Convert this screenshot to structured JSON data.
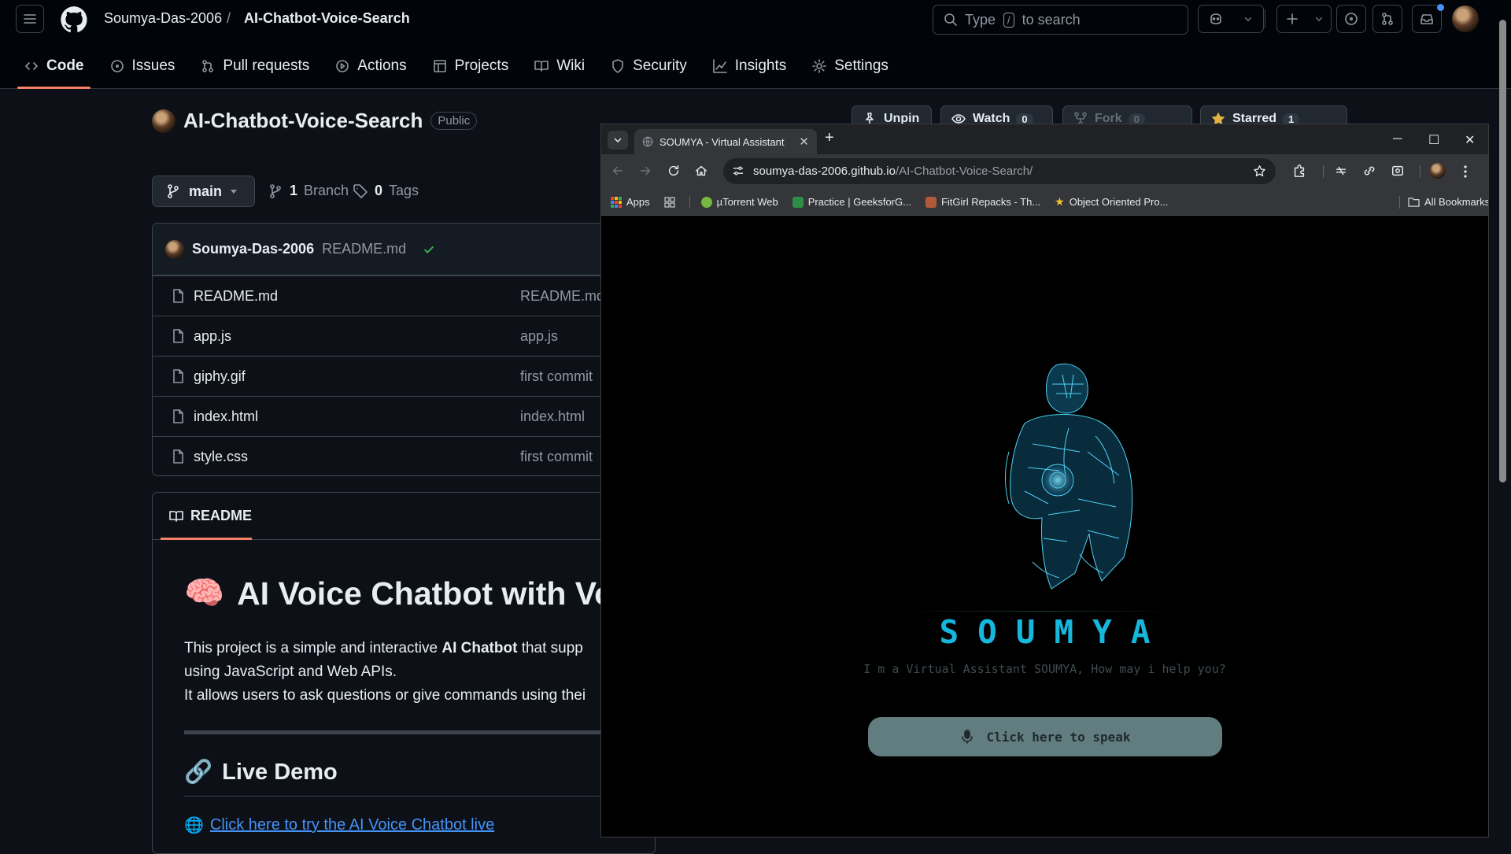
{
  "github": {
    "header": {
      "owner": "Soumya-Das-2006",
      "separator": "/",
      "repo": "AI-Chatbot-Voice-Search",
      "search": {
        "prefix": "Type",
        "key": "/",
        "suffix": "to search"
      }
    },
    "tabs": [
      {
        "label": "Code",
        "icon": "code-icon",
        "active": true
      },
      {
        "label": "Issues",
        "icon": "issue-icon"
      },
      {
        "label": "Pull requests",
        "icon": "pull-request-icon"
      },
      {
        "label": "Actions",
        "icon": "play-icon"
      },
      {
        "label": "Projects",
        "icon": "table-icon"
      },
      {
        "label": "Wiki",
        "icon": "book-icon"
      },
      {
        "label": "Security",
        "icon": "shield-icon"
      },
      {
        "label": "Insights",
        "icon": "graph-icon"
      },
      {
        "label": "Settings",
        "icon": "gear-icon"
      }
    ],
    "repo": {
      "name": "AI-Chatbot-Voice-Search",
      "visibility": "Public",
      "unpin": "Unpin",
      "watch": "Watch",
      "watch_count": "0",
      "fork": "Fork",
      "fork_count": "0",
      "starred": "Starred",
      "star_count": "1"
    },
    "branch": {
      "current": "main",
      "branch_count": "1",
      "branch_label": "Branch",
      "tag_count": "0",
      "tag_label": "Tags"
    },
    "last_commit": {
      "author": "Soumya-Das-2006",
      "message": "README.md"
    },
    "files": [
      {
        "name": "README.md",
        "commit": "README.md"
      },
      {
        "name": "app.js",
        "commit": "app.js"
      },
      {
        "name": "giphy.gif",
        "commit": "first commit"
      },
      {
        "name": "index.html",
        "commit": "index.html"
      },
      {
        "name": "style.css",
        "commit": "first commit"
      }
    ],
    "readme": {
      "tab": "README",
      "h1_emoji": "🧠",
      "h1": "AI Voice Chatbot with Voi",
      "p1_a": "This project is a simple and interactive ",
      "p1_b": "AI Chatbot",
      "p1_c": " that supp",
      "p2": "using JavaScript and Web APIs.",
      "p3": "It allows users to ask questions or give commands using thei",
      "h2_emoji": "🔗",
      "h2": "Live Demo",
      "link_emoji": "🌐",
      "link": "Click here to try the AI Voice Chatbot live"
    }
  },
  "browser": {
    "tab_title": "SOUMYA - Virtual Assistant",
    "url_host": "soumya-das-2006.github.io",
    "url_path": "/AI-Chatbot-Voice-Search/",
    "bookmarks": [
      {
        "label": "Apps",
        "color": "#4285f4"
      },
      {
        "label": "µTorrent Web",
        "color": "#76b83f"
      },
      {
        "label": "Practice | GeeksforG...",
        "color": "#2f8d46"
      },
      {
        "label": "FitGirl Repacks - Th...",
        "color": "#b05a3a"
      },
      {
        "label": "Object Oriented Pro...",
        "color": "#f4c430"
      }
    ],
    "all_bookmarks": "All Bookmarks",
    "page": {
      "title": "SOUMYA",
      "subtitle": "I m a Virtual Assistant SOUMYA, How may i help you?",
      "speak_button": "Click here to speak"
    }
  }
}
